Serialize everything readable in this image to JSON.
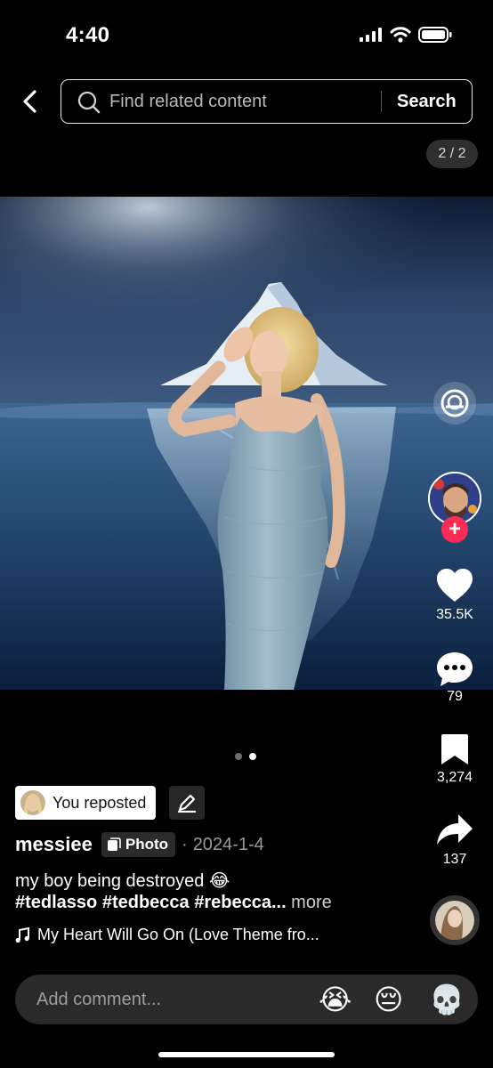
{
  "status_bar": {
    "time": "4:40"
  },
  "header": {
    "search_placeholder": "Find related content",
    "search_button": "Search",
    "page_counter": "2 / 2"
  },
  "rail": {
    "likes": "35.5K",
    "comments": "79",
    "bookmarks": "3,274",
    "shares": "137"
  },
  "post": {
    "repost_label": "You reposted",
    "author": "messiee",
    "type_tag": "Photo",
    "separator": "·",
    "date": "2024-1-4",
    "caption_text": "my boy being destroyed 😂",
    "hashtags": "#tedlasso #tedbecca #rebecca...",
    "more_label": " more",
    "sound": "My Heart Will Go On (Love Theme fro..."
  },
  "carousel": {
    "current": 2,
    "total": 2
  },
  "comment_bar": {
    "placeholder": "Add comment...",
    "emojis": [
      "😭",
      "😔",
      "💀"
    ]
  },
  "colors": {
    "follow": "#fe2c55",
    "background": "#000000"
  }
}
